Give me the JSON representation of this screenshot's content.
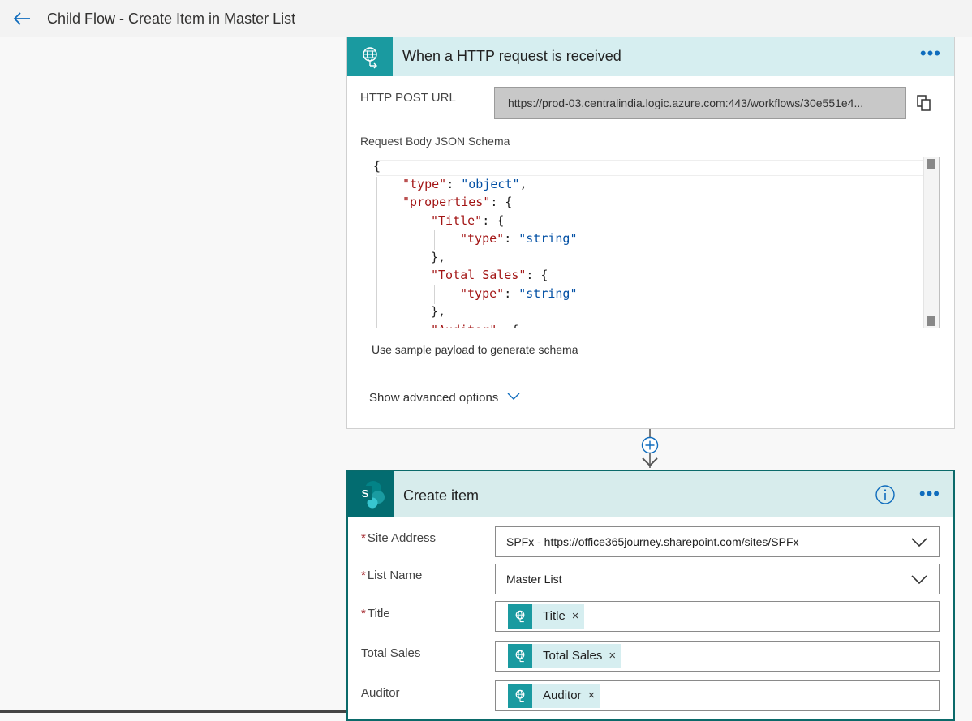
{
  "header": {
    "flow_title": "Child Flow - Create Item in Master List"
  },
  "http_trigger": {
    "title": "When a HTTP request is received",
    "more_label": "•••",
    "url_label": "HTTP POST URL",
    "url_value": "https://prod-03.centralindia.logic.azure.com:443/workflows/30e551e4...",
    "schema_label": "Request Body JSON Schema",
    "schema_lines": [
      {
        "pre": "{",
        "key": "",
        "mid": "",
        "val": "",
        "post": ""
      },
      {
        "pre": "",
        "key": "\"type\"",
        "mid": ": ",
        "val": "\"object\"",
        "post": ","
      },
      {
        "pre": "",
        "key": "\"properties\"",
        "mid": ": {",
        "val": "",
        "post": ""
      },
      {
        "pre": "",
        "key": "\"Title\"",
        "mid": ": {",
        "val": "",
        "post": ""
      },
      {
        "pre": "",
        "key": "\"type\"",
        "mid": ": ",
        "val": "\"string\"",
        "post": ""
      },
      {
        "pre": "},",
        "key": "",
        "mid": "",
        "val": "",
        "post": ""
      },
      {
        "pre": "",
        "key": "\"Total Sales\"",
        "mid": ": {",
        "val": "",
        "post": ""
      },
      {
        "pre": "",
        "key": "\"type\"",
        "mid": ": ",
        "val": "\"string\"",
        "post": ""
      },
      {
        "pre": "},",
        "key": "",
        "mid": "",
        "val": "",
        "post": ""
      },
      {
        "pre": "",
        "key": "\"Auditor\"",
        "mid": ": {",
        "val": "",
        "post": ""
      }
    ],
    "sample_payload_link": "Use sample payload to generate schema",
    "advanced_options": "Show advanced options"
  },
  "create_item": {
    "title": "Create item",
    "more_label": "•••",
    "fields": {
      "site_address": {
        "label": "Site Address",
        "required_mark": "*",
        "value": "SPFx - https://office365journey.sharepoint.com/sites/SPFx"
      },
      "list_name": {
        "label": "List Name",
        "required_mark": "*",
        "value": "Master List"
      },
      "title": {
        "label": "Title",
        "required_mark": "*",
        "token": "Title"
      },
      "total_sales": {
        "label": "Total Sales",
        "token": "Total Sales"
      },
      "auditor": {
        "label": "Auditor",
        "token": "Auditor"
      }
    },
    "token_remove": "×"
  },
  "colors": {
    "accent_blue": "#0f6cbd",
    "http_teal": "#1a9aa0",
    "sharepoint_teal": "#036c70",
    "json_key": "#a31515",
    "json_string": "#0451a5"
  },
  "icons": [
    "back-arrow-icon",
    "globe-request-icon",
    "more-icon",
    "copy-icon",
    "chevron-down-icon",
    "add-step-icon",
    "sharepoint-icon",
    "info-icon",
    "token-close-icon"
  ]
}
